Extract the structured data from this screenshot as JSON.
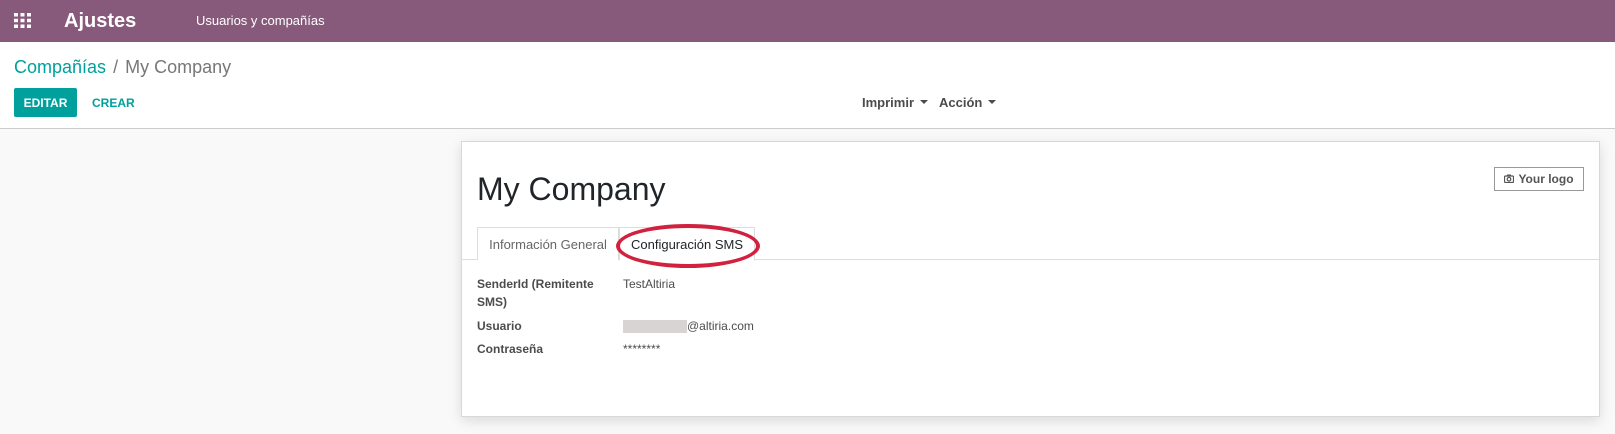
{
  "navbar": {
    "app_title": "Ajustes",
    "menu_item": "Usuarios y compañías",
    "apps_icon": "grid-icon",
    "color": "#875a7b"
  },
  "breadcrumb": {
    "parent": "Compañías",
    "separator": "/",
    "current": "My Company"
  },
  "toolbar": {
    "edit_label": "EDITAR",
    "create_label": "CREAR",
    "print_label": "Imprimir",
    "action_label": "Acción",
    "accent_color": "#00a09d"
  },
  "form": {
    "title": "My Company",
    "logo_button": "Your logo",
    "logo_icon": "camera-icon",
    "tabs": [
      {
        "label": "Información General",
        "active": false
      },
      {
        "label": "Configuración SMS",
        "active": true
      }
    ],
    "highlight_color": "#d1213f",
    "fields": [
      {
        "label": "SenderId (Remitente SMS)",
        "value": "TestAltiria"
      },
      {
        "label": "Usuario",
        "value": "@altiria.com",
        "redacted_prefix": true
      },
      {
        "label": "Contraseña",
        "value": "********"
      }
    ]
  }
}
